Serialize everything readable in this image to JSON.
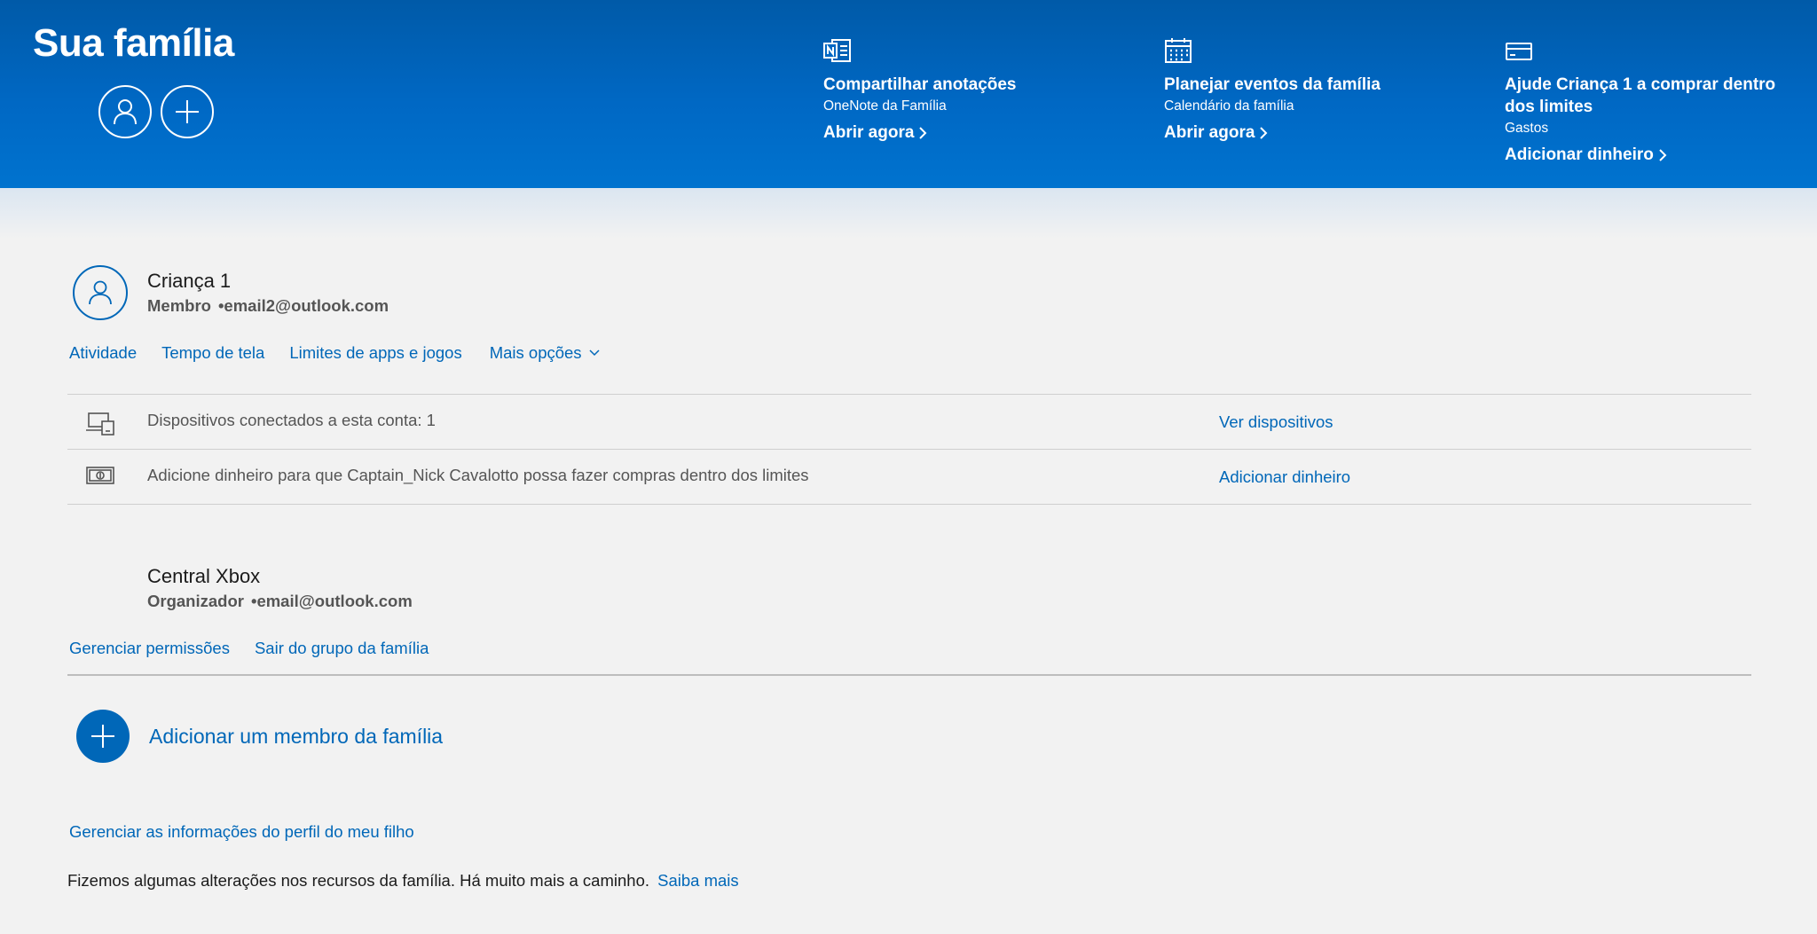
{
  "header": {
    "title": "Sua família",
    "promos": [
      {
        "icon": "onenote-icon",
        "title": "Compartilhar anotações",
        "subtitle": "OneNote da Família",
        "link": "Abrir agora"
      },
      {
        "icon": "calendar-icon",
        "title": "Planejar eventos da família",
        "subtitle": "Calendário da família",
        "link": "Abrir agora"
      },
      {
        "icon": "card-icon",
        "title": "Ajude Criança 1 a comprar dentro dos limites",
        "subtitle": "Gastos",
        "link": "Adicionar dinheiro"
      }
    ]
  },
  "child": {
    "name": "Criança 1",
    "role": "Membro",
    "email": "•email2@outlook.com",
    "tabs": [
      "Atividade",
      "Tempo de tela",
      "Limites de apps e jogos",
      "Mais opções"
    ],
    "rows": [
      {
        "icon": "devices-icon",
        "text": "Dispositivos conectados a esta conta: 1",
        "link": "Ver dispositivos"
      },
      {
        "icon": "money-icon",
        "text": "Adicione dinheiro para que Captain_Nick Cavalotto possa fazer compras dentro dos limites",
        "link": "Adicionar dinheiro"
      }
    ]
  },
  "organizer": {
    "name": "Central Xbox",
    "role": "Organizador",
    "email": "•email@outlook.com",
    "links": [
      "Gerenciar permissões",
      "Sair do grupo da família"
    ]
  },
  "add_member_label": "Adicionar um membro da família",
  "manage_profile_link": "Gerenciar as informações do perfil do meu filho",
  "footer": {
    "text": "Fizemos algumas alterações nos recursos da família. Há muito mais a caminho.",
    "link": "Saiba mais"
  },
  "colors": {
    "accent": "#0067b8",
    "banner": "#0068c4"
  }
}
